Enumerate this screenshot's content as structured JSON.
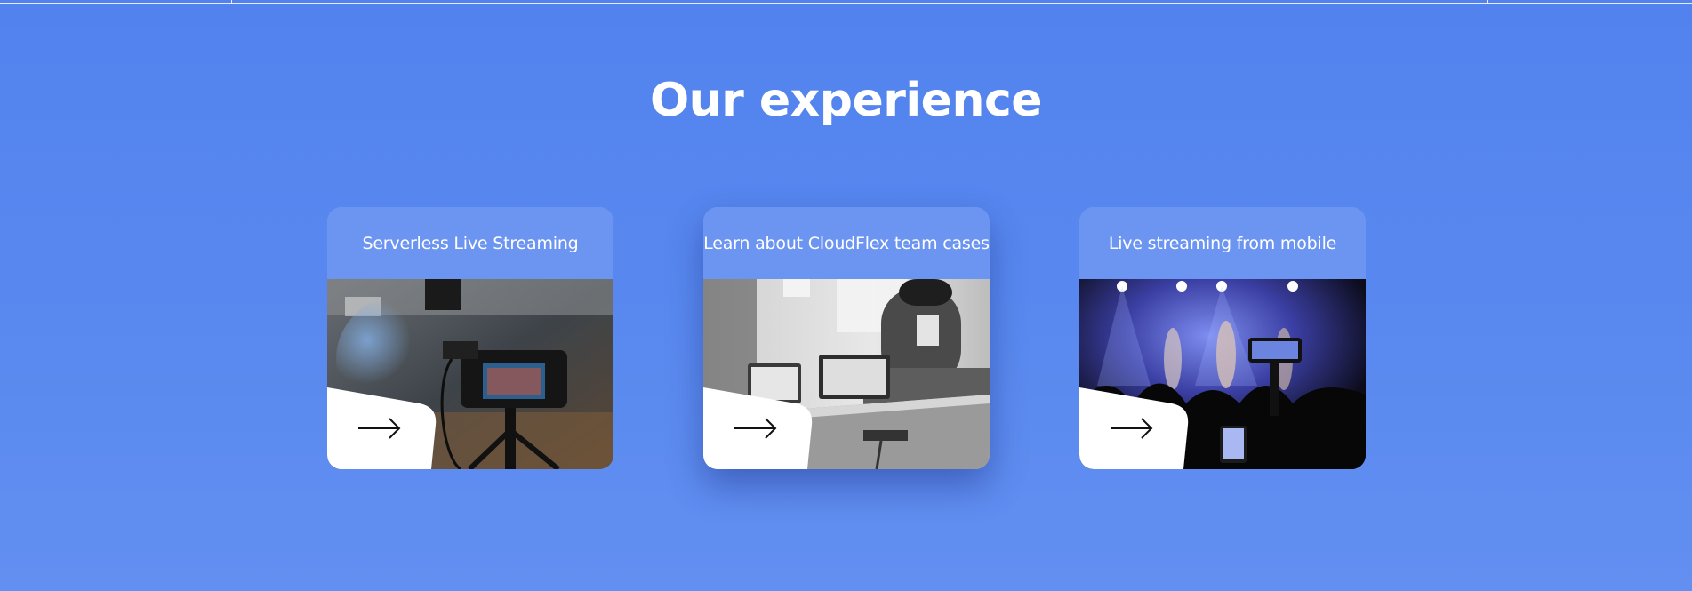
{
  "section": {
    "title": "Our experience"
  },
  "cards": [
    {
      "title": "Serverless Live Streaming",
      "image": "camera-studio-photo",
      "icon": "arrow-right-icon"
    },
    {
      "title": "Learn about CloudFlex team cases",
      "image": "team-meeting-photo",
      "icon": "arrow-right-icon"
    },
    {
      "title": "Live streaming from mobile",
      "image": "concert-phone-photo",
      "icon": "arrow-right-icon"
    }
  ],
  "colors": {
    "background": "#5282ee",
    "card_header": "#6c95f2",
    "text": "#ffffff"
  }
}
